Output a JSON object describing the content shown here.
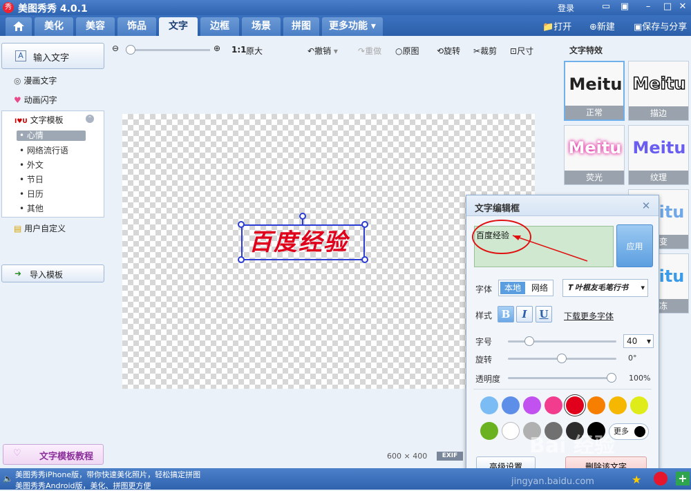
{
  "titlebar": {
    "logo": "秀",
    "title": "美图秀秀 4.0.1",
    "login": "登录",
    "icons": [
      "chat-icon",
      "skin-icon",
      "minimize-icon",
      "maximize-icon",
      "close-icon"
    ]
  },
  "tabs": [
    {
      "label": "",
      "icon": "home-icon"
    },
    {
      "label": "美化"
    },
    {
      "label": "美容"
    },
    {
      "label": "饰品"
    },
    {
      "label": "文字"
    },
    {
      "label": "边框"
    },
    {
      "label": "场景"
    },
    {
      "label": "拼图"
    },
    {
      "label": "更多功能"
    }
  ],
  "tabbar_actions": {
    "open": "打开",
    "new": "新建",
    "save_share": "保存与分享"
  },
  "left": {
    "input_text": "输入文字",
    "comic_text": "漫画文字",
    "anim_text": "动画闪字",
    "templates": "文字模板",
    "template_items": [
      "心情",
      "网络流行语",
      "外文",
      "节日",
      "日历",
      "其他"
    ],
    "user_custom": "用户自定义",
    "import_template": "导入模板",
    "tutorial": "文字模板教程"
  },
  "toolbar": {
    "ratio": "1:1",
    "original_size": "原大",
    "undo": "撤销",
    "redo": "重做",
    "original": "原图",
    "rotate": "旋转",
    "crop": "裁剪",
    "size": "尺寸"
  },
  "canvas": {
    "art_text": "百度经验",
    "dimensions": "600 × 400",
    "exif": "EXIF"
  },
  "effects": {
    "title": "文字特效",
    "cards": [
      {
        "art": "Meitu",
        "label": "正常"
      },
      {
        "art": "Meitu",
        "label": "描边"
      },
      {
        "art": "Meitu",
        "label": "荧光"
      },
      {
        "art": "Meitu",
        "label": "纹理"
      },
      {
        "art": "itu",
        "label": "变"
      },
      {
        "art": "itu",
        "label": "冻"
      }
    ]
  },
  "dialog": {
    "title": "文字编辑框",
    "text_value": "百度经验",
    "apply": "应用",
    "font_label": "字体",
    "local": "本地",
    "network": "网络",
    "font_name": "叶根友毛笔行书",
    "style_label": "样式",
    "bold": "B",
    "italic": "I",
    "underline": "U",
    "download_fonts": "下载更多字体",
    "size_label": "字号",
    "size_value": "40",
    "rotate_label": "旋转",
    "rotate_value": "0°",
    "opacity_label": "透明度",
    "opacity_value": "100%",
    "more_colors": "更多",
    "advanced": "高级设置",
    "delete": "删除该文字",
    "colors": [
      "#7cbcf5",
      "#5e8fe8",
      "#c252f0",
      "#f23d8e",
      "#e0001b",
      "#f77f00",
      "#f5b700",
      "#e0ec1a",
      "#6ab21f",
      "#ffffff",
      "#b0b0b0",
      "#707070",
      "#2c2c2c",
      "#000000"
    ]
  },
  "statusbar": {
    "line1": "美图秀秀iPhone版，带你快速美化照片，轻松搞定拼图",
    "line2": "美图秀秀Android版，美化、拼图更方便"
  },
  "watermark": {
    "brand": "Bai 经验",
    "site": "jingyan.baidu.com"
  }
}
